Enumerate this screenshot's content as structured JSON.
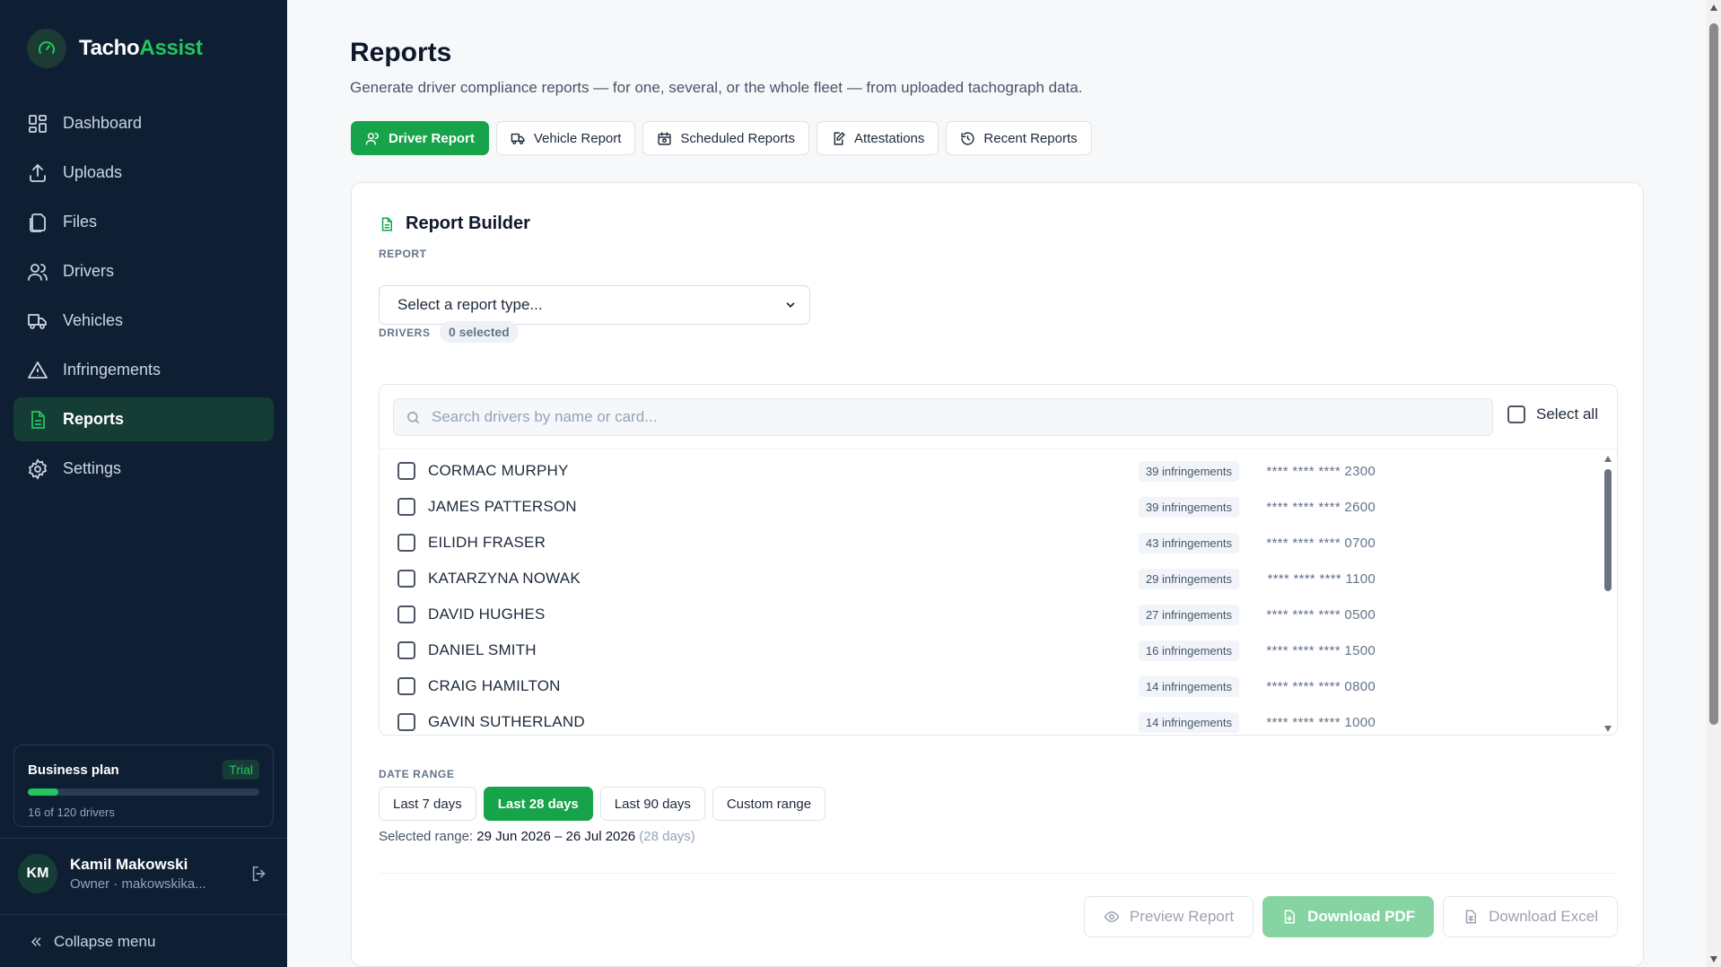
{
  "brand": {
    "name_a": "Tacho",
    "name_b": "Assist"
  },
  "nav": [
    {
      "label": "Dashboard",
      "icon": "grid-icon"
    },
    {
      "label": "Uploads",
      "icon": "upload-icon"
    },
    {
      "label": "Files",
      "icon": "files-icon"
    },
    {
      "label": "Drivers",
      "icon": "users-icon"
    },
    {
      "label": "Vehicles",
      "icon": "truck-icon"
    },
    {
      "label": "Infringements",
      "icon": "warning-icon"
    },
    {
      "label": "Reports",
      "icon": "report-icon",
      "active": true
    },
    {
      "label": "Settings",
      "icon": "gear-icon"
    }
  ],
  "plan": {
    "title": "Business plan",
    "badge": "Trial",
    "used_text": "16 of 120 drivers",
    "used": 16,
    "total": 120
  },
  "user": {
    "initials": "KM",
    "name": "Kamil Makowski",
    "role": "Owner · makowskika..."
  },
  "collapse_label": "Collapse menu",
  "page": {
    "title": "Reports",
    "subtitle": "Generate driver compliance reports — for one, several, or the whole fleet — from uploaded tachograph data."
  },
  "tabs": [
    {
      "label": "Driver Report",
      "active": true
    },
    {
      "label": "Vehicle Report"
    },
    {
      "label": "Scheduled Reports"
    },
    {
      "label": "Attestations"
    },
    {
      "label": "Recent Reports"
    }
  ],
  "builder": {
    "title": "Report Builder",
    "report_label": "REPORT",
    "report_select": "Select a report type...",
    "drivers_label": "DRIVERS",
    "selected_count": "0 selected",
    "search_placeholder": "Search drivers by name or card...",
    "select_all": "Select all",
    "drivers": [
      {
        "name": "CORMAC MURPHY",
        "infringements": "39 infringements",
        "card": "**** **** **** 2300"
      },
      {
        "name": "JAMES PATTERSON",
        "infringements": "39 infringements",
        "card": "**** **** **** 2600"
      },
      {
        "name": "EILIDH FRASER",
        "infringements": "43 infringements",
        "card": "**** **** **** 0700"
      },
      {
        "name": "KATARZYNA NOWAK",
        "infringements": "29 infringements",
        "card": "**** **** **** 1100"
      },
      {
        "name": "DAVID HUGHES",
        "infringements": "27 infringements",
        "card": "**** **** **** 0500"
      },
      {
        "name": "DANIEL SMITH",
        "infringements": "16 infringements",
        "card": "**** **** **** 1500"
      },
      {
        "name": "CRAIG HAMILTON",
        "infringements": "14 infringements",
        "card": "**** **** **** 0800"
      },
      {
        "name": "GAVIN SUTHERLAND",
        "infringements": "14 infringements",
        "card": "**** **** **** 1000"
      }
    ],
    "date_label": "DATE RANGE",
    "ranges": [
      {
        "label": "Last 7 days"
      },
      {
        "label": "Last 28 days",
        "active": true
      },
      {
        "label": "Last 90 days"
      },
      {
        "label": "Custom range"
      }
    ],
    "selected_range_prefix": "Selected range:",
    "selected_range": "29 Jun 2026 – 26 Jul 2026",
    "selected_days": "(28 days)",
    "actions": {
      "preview": "Preview Report",
      "pdf": "Download PDF",
      "excel": "Download Excel"
    }
  },
  "colors": {
    "sidebar": "#0f1f33",
    "accent": "#16a34a",
    "brand_green": "#22c55e"
  }
}
